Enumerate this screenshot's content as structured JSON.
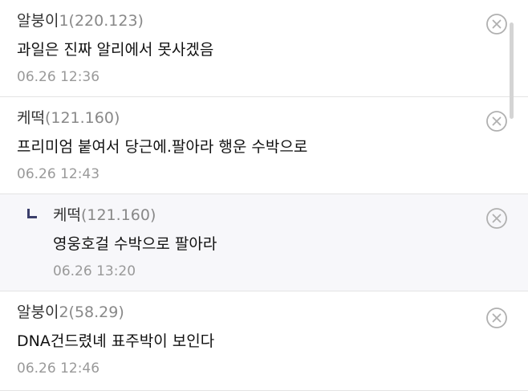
{
  "comments": [
    {
      "nickname": "알붕이",
      "gallery_suffix": "1",
      "ip": "(220.123)",
      "text": "과일은 진짜 알리에서 못사겠음",
      "date": "06.26 12:36",
      "is_reply": false
    },
    {
      "nickname": "케떡",
      "gallery_suffix": "",
      "ip": "(121.160)",
      "text": "프리미엄 붙여서 당근에.팔아라 행운 수박으로",
      "date": "06.26 12:43",
      "is_reply": false
    },
    {
      "nickname": "케떡",
      "gallery_suffix": "",
      "ip": "(121.160)",
      "text": "영웅호걸 수박으로 팔아라",
      "date": "06.26 13:20",
      "is_reply": true
    },
    {
      "nickname": "알붕이",
      "gallery_suffix": "2",
      "ip": "(58.29)",
      "text": "DNA건드렸녜 표주박이 보인다",
      "date": "06.26 12:46",
      "is_reply": false
    }
  ],
  "icons": {
    "delete": "circle-x-icon",
    "reply": "reply-arrow-icon"
  },
  "colors": {
    "reply_background": "#f7f7fa",
    "meta_text": "#888888",
    "reply_arrow": "#3b3f6b"
  }
}
